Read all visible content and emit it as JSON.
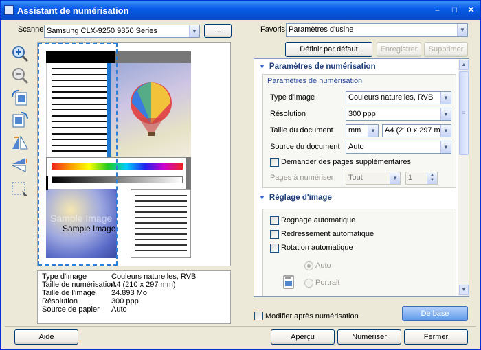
{
  "window": {
    "title": "Assistant de numérisation",
    "minimize": "–",
    "maximize": "□",
    "close": "✕"
  },
  "scanner": {
    "label": "Scanner",
    "value": "Samsung CLX-9250 9350 Series",
    "browse": "..."
  },
  "favoris": {
    "label": "Favoris",
    "value": "Paramètres d'usine"
  },
  "buttons": {
    "default": "Définir par défaut",
    "save": "Enregistrer",
    "delete": "Supprimer",
    "basic": "De base",
    "help": "Aide",
    "preview": "Aperçu",
    "scan": "Numériser",
    "close": "Fermer"
  },
  "preview": {
    "sample_text": "Sample Image",
    "sample_text2": "Sample Image"
  },
  "info": {
    "rows": [
      {
        "label": "Type d'image",
        "value": "Couleurs naturelles, RVB"
      },
      {
        "label": "Taille de numérisation",
        "value": "A4 (210 x 297 mm)"
      },
      {
        "label": "Taille de l'image",
        "value": "24.893 Mo"
      },
      {
        "label": "Résolution",
        "value": "300 ppp"
      },
      {
        "label": "Source de papier",
        "value": "Auto"
      }
    ]
  },
  "scan_params": {
    "section": "Paramètres de numérisation",
    "group": "Paramètres de numérisation",
    "image_type": {
      "label": "Type d'image",
      "value": "Couleurs naturelles, RVB"
    },
    "resolution": {
      "label": "Résolution",
      "value": "300 ppp"
    },
    "doc_size": {
      "label": "Taille du document",
      "unit": "mm",
      "value": "A4 (210 x 297 mm)"
    },
    "doc_source": {
      "label": "Source du document",
      "value": "Auto"
    },
    "extra_pages": "Demander des pages supplémentaires",
    "pages": {
      "label": "Pages à numériser",
      "value": "Tout",
      "count": "1"
    }
  },
  "image_adjust": {
    "section": "Réglage d'image",
    "auto_crop": "Rognage automatique",
    "auto_straighten": "Redressement automatique",
    "auto_rotate": "Rotation automatique",
    "radio_auto": "Auto",
    "radio_portrait": "Portrait"
  },
  "modify_after": "Modifier après numérisation"
}
